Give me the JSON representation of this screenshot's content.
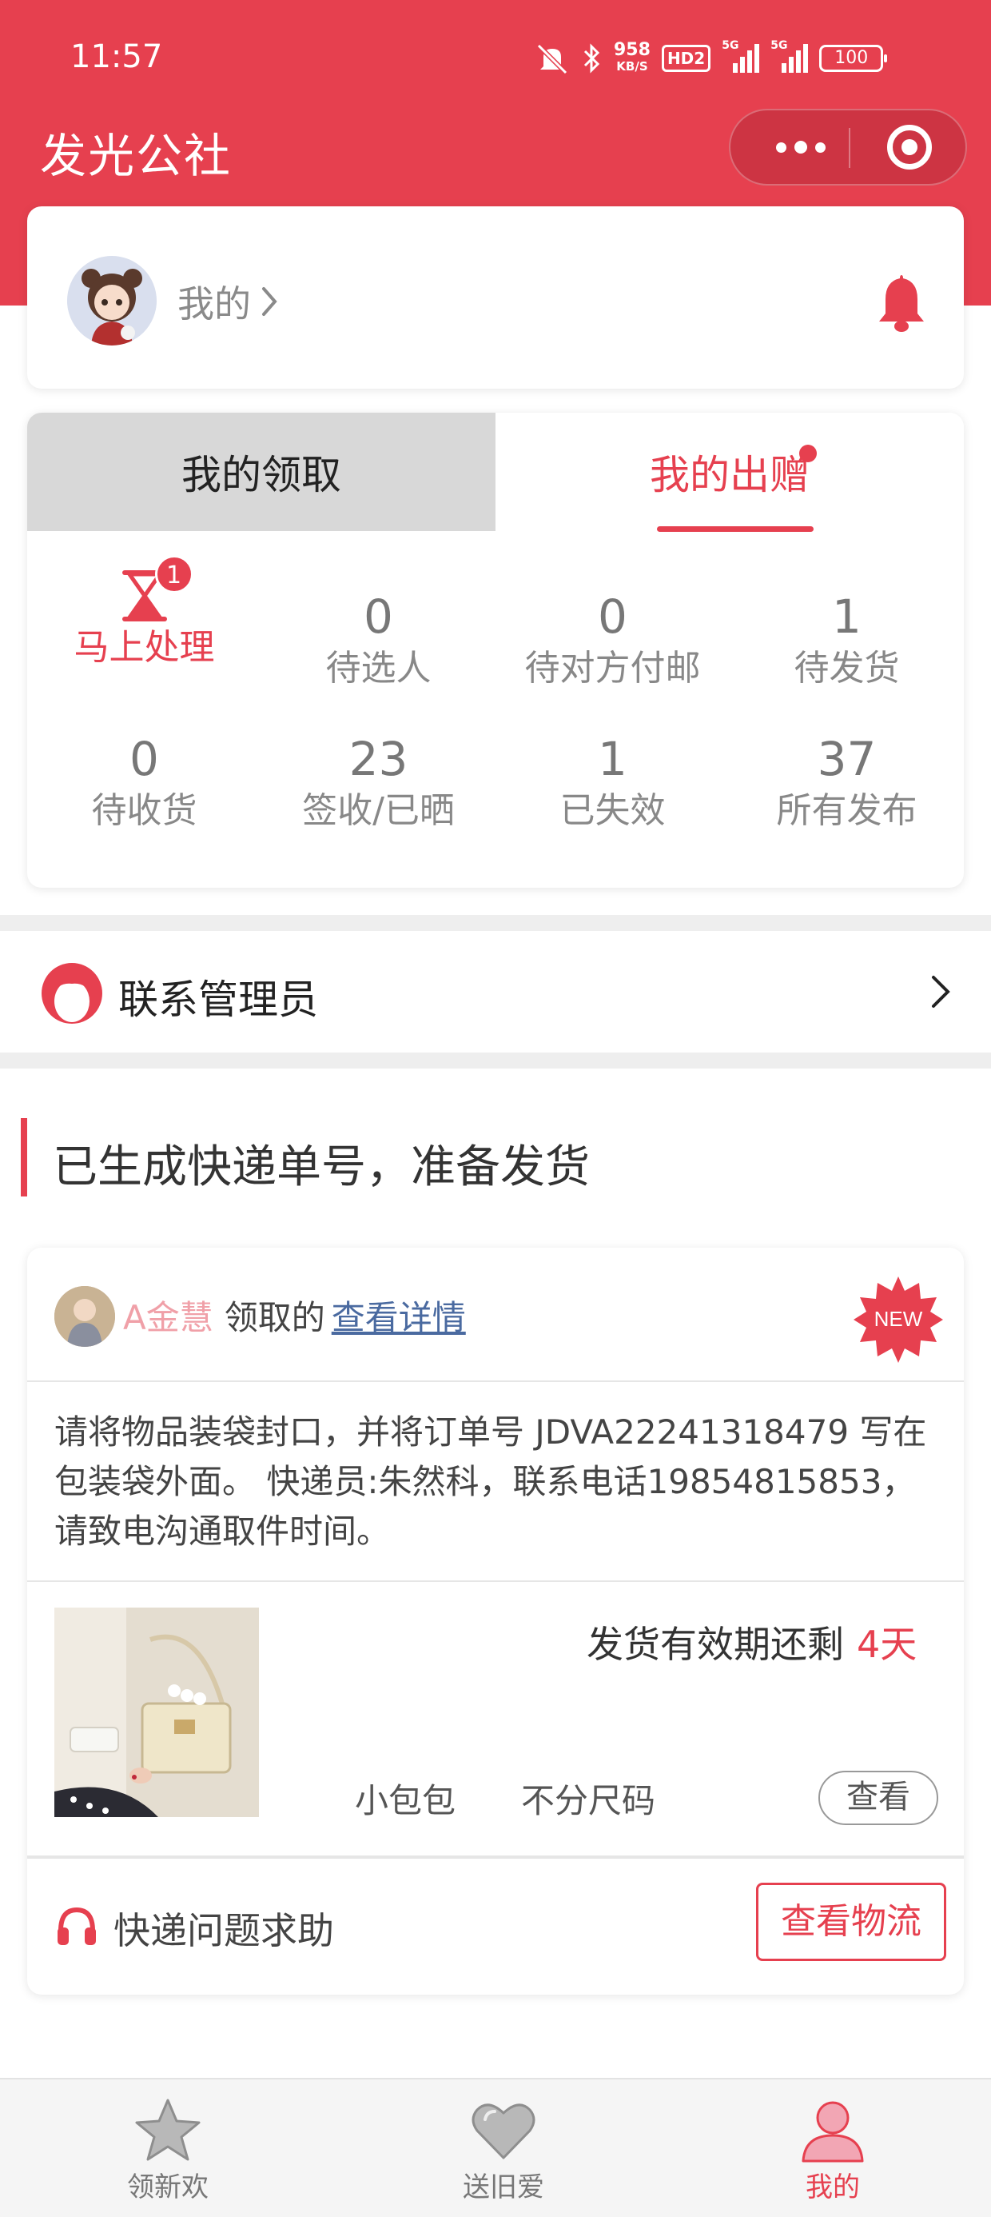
{
  "status_bar": {
    "time": "11:57",
    "net_speed": "958",
    "net_unit": "KB/S",
    "hd": "HD2",
    "net_type_1": "5G",
    "net_type_2": "5G",
    "battery": "100"
  },
  "app": {
    "title": "发光公社"
  },
  "profile": {
    "link_label": "我的"
  },
  "tabs": {
    "left_label": "我的领取",
    "right_label": "我的出赠"
  },
  "stats": [
    {
      "value": "",
      "label": "马上处理",
      "badge": "1"
    },
    {
      "value": "0",
      "label": "待选人"
    },
    {
      "value": "0",
      "label": "待对方付邮"
    },
    {
      "value": "1",
      "label": "待发货"
    },
    {
      "value": "0",
      "label": "待收货"
    },
    {
      "value": "23",
      "label": "签收/已晒"
    },
    {
      "value": "1",
      "label": "已失效"
    },
    {
      "value": "37",
      "label": "所有发布"
    }
  ],
  "admin": {
    "label": "联系管理员"
  },
  "section": {
    "title": "已生成快递单号，准备发货"
  },
  "order": {
    "uploader_name": "A金慧",
    "action": "领取的",
    "detail_link": "查看详情",
    "new_badge": "NEW",
    "instructions": "请将物品装袋封口，并将订单号 JDVA22241318479 写在包装袋外面。 快递员:朱然科，联系电话19854815853，请致电沟通取件时间。",
    "valid_prefix": "发货有效期还剩",
    "valid_days": "4天",
    "product_name": "小包包",
    "product_size": "不分尺码",
    "view_label": "查看",
    "help_label": "快递问题求助",
    "logistics_label": "查看物流"
  },
  "bottom_nav": [
    {
      "label": "领新欢",
      "icon": "star-icon"
    },
    {
      "label": "送旧爱",
      "icon": "heart-icon"
    },
    {
      "label": "我的",
      "icon": "user-icon"
    }
  ],
  "colors": {
    "brand": "#e6404f",
    "muted": "#888888"
  }
}
